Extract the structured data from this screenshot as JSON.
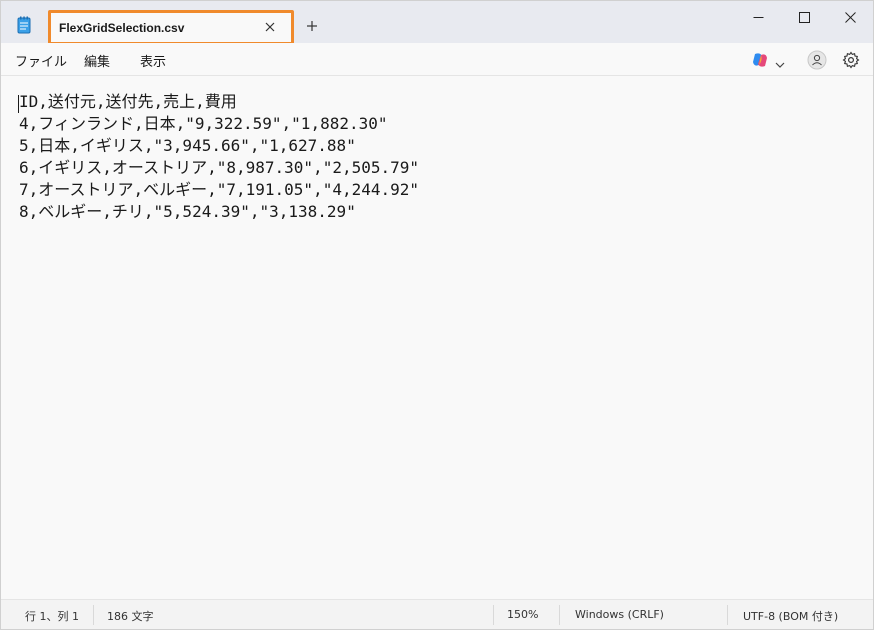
{
  "tab": {
    "title": "FlexGridSelection.csv"
  },
  "menu": {
    "file": "ファイル",
    "edit": "編集",
    "view": "表示"
  },
  "editor": {
    "lines": [
      "ID,送付元,送付先,売上,費用",
      "4,フィンランド,日本,\"9,322.59\",\"1,882.30\"",
      "5,日本,イギリス,\"3,945.66\",\"1,627.88\"",
      "6,イギリス,オーストリア,\"8,987.30\",\"2,505.79\"",
      "7,オーストリア,ベルギー,\"7,191.05\",\"4,244.92\"",
      "8,ベルギー,チリ,\"5,524.39\",\"3,138.29\""
    ]
  },
  "status": {
    "position": "行 1、列 1",
    "chars": "186 文字",
    "zoom": "150%",
    "line_ending": "Windows (CRLF)",
    "encoding": "UTF-8 (BOM 付き)"
  },
  "icons": {
    "app": "notepad-icon",
    "close_tab": "close-icon",
    "new_tab": "plus-icon",
    "minimize": "minimize-icon",
    "maximize": "maximize-icon",
    "close": "close-icon",
    "copilot": "copilot-icon",
    "account": "account-icon",
    "settings": "gear-icon"
  },
  "colors": {
    "tab_highlight": "#f08a2c",
    "titlebar": "#e8eaf0"
  }
}
